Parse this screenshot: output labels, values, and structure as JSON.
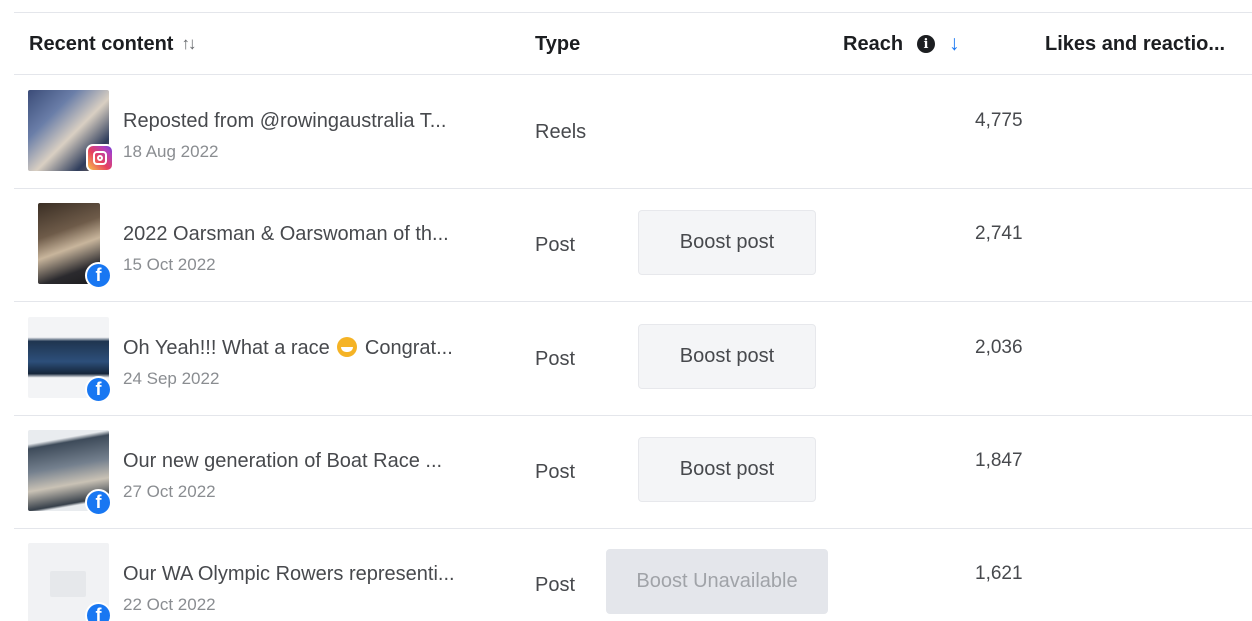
{
  "header": {
    "recent_content": "Recent content",
    "type": "Type",
    "reach": "Reach",
    "likes": "Likes and reactio..."
  },
  "rows": [
    {
      "title": "Reposted from @rowingaustralia T...",
      "date": "18 Aug 2022",
      "type": "Reels",
      "boost": "",
      "reach": "4,775",
      "platform": "instagram-icon"
    },
    {
      "title": "2022 Oarsman & Oarswoman of th...",
      "date": "15 Oct 2022",
      "type": "Post",
      "boost": "Boost post",
      "reach": "2,741",
      "platform": "facebook-icon"
    },
    {
      "title_prefix": "Oh Yeah!!! What a race",
      "title_suffix": "Congrat...",
      "date": "24 Sep 2022",
      "type": "Post",
      "boost": "Boost post",
      "reach": "2,036",
      "platform": "facebook-icon"
    },
    {
      "title": "Our new generation of Boat Race ...",
      "date": "27 Oct 2022",
      "type": "Post",
      "boost": "Boost post",
      "reach": "1,847",
      "platform": "facebook-icon"
    },
    {
      "title": "Our WA Olympic Rowers representi...",
      "date": "22 Oct 2022",
      "type": "Post",
      "boost": "Boost Unavailable",
      "reach": "1,621",
      "platform": "facebook-icon"
    }
  ],
  "colors": {
    "accent": "#1877f2",
    "border": "#e4e6eb",
    "button_bg": "#f4f5f7",
    "disabled_bg": "#e4e6eb"
  }
}
